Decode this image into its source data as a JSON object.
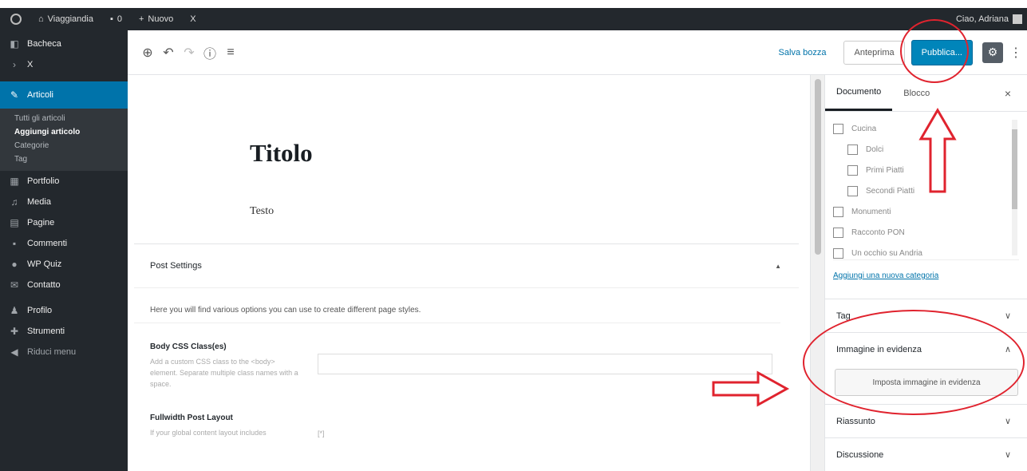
{
  "adminbar": {
    "site_name": "Viaggiandia",
    "comments_count": "0",
    "new_label": "Nuovo",
    "extra": "X",
    "greeting": "Ciao, Adriana"
  },
  "sidebar_menu": {
    "items": [
      {
        "label": "Bacheca",
        "icon": "dashboard-icon"
      },
      {
        "label": "X",
        "icon": "chevron-right-icon"
      },
      {
        "label": "Articoli",
        "icon": "pin-icon"
      },
      {
        "label": "Portfolio",
        "icon": "portfolio-icon"
      },
      {
        "label": "Media",
        "icon": "media-icon"
      },
      {
        "label": "Pagine",
        "icon": "pages-icon"
      },
      {
        "label": "Commenti",
        "icon": "comments-icon"
      },
      {
        "label": "WP Quiz",
        "icon": "quiz-icon"
      },
      {
        "label": "Contatto",
        "icon": "mail-icon"
      },
      {
        "label": "Profilo",
        "icon": "user-icon"
      },
      {
        "label": "Strumenti",
        "icon": "tools-icon"
      },
      {
        "label": "Riduci menu",
        "icon": "collapse-icon"
      }
    ],
    "submenu": [
      "Tutti gli articoli",
      "Aggiungi articolo",
      "Categorie",
      "Tag"
    ]
  },
  "toolbar": {
    "save_draft": "Salva bozza",
    "preview": "Anteprima",
    "publish": "Pubblica..."
  },
  "post": {
    "title": "Titolo",
    "text": "Testo"
  },
  "post_settings": {
    "heading": "Post Settings",
    "description": "Here you will find various options you can use to create different page styles.",
    "body_css_label": "Body CSS Class(es)",
    "body_css_hint": "Add a custom CSS class to the <body> element. Separate multiple class names with a space.",
    "fullwidth_label": "Fullwidth Post Layout",
    "fullwidth_hint": "If your global content layout includes",
    "fullwidth_value": "[*]"
  },
  "settings_sidebar": {
    "tab_document": "Documento",
    "tab_block": "Blocco",
    "categories": [
      {
        "label": "Cucina",
        "indent": false
      },
      {
        "label": "Dolci",
        "indent": true
      },
      {
        "label": "Primi Piatti",
        "indent": true
      },
      {
        "label": "Secondi Piatti",
        "indent": true
      },
      {
        "label": "Monumenti",
        "indent": false
      },
      {
        "label": "Racconto PON",
        "indent": false
      },
      {
        "label": "Un occhio su Andria",
        "indent": false
      }
    ],
    "add_category": "Aggiungi una nuova categoria",
    "panel_tag": "Tag",
    "panel_featured": "Immagine in evidenza",
    "featured_button": "Imposta immagine in evidenza",
    "panel_excerpt": "Riassunto",
    "panel_discussion": "Discussione"
  },
  "colors": {
    "admin_bg": "#23282d",
    "accent": "#0073aa",
    "publish": "#0085ba",
    "annotation": "#e0232e"
  }
}
